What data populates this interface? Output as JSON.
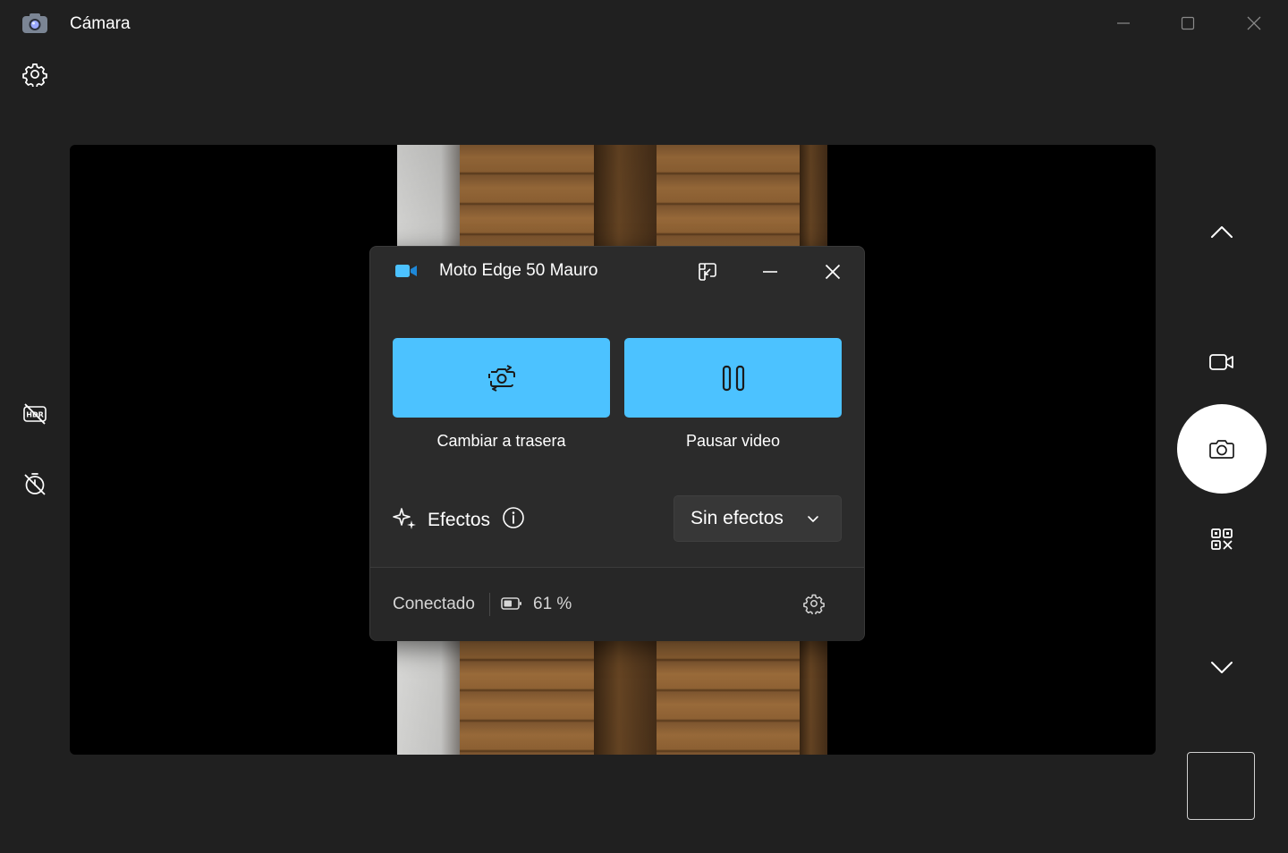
{
  "window": {
    "title": "Cámara"
  },
  "toolbar": {
    "settings_icon": "gear-icon"
  },
  "left_controls": [
    {
      "name": "hdr-off-icon"
    },
    {
      "name": "timer-off-icon"
    }
  ],
  "right_controls": {
    "up": "chevron-up-icon",
    "video_mode": "video-camera-icon",
    "shutter": "camera-icon",
    "qr_mode": "qr-code-icon",
    "down": "chevron-down-icon"
  },
  "phone_dialog": {
    "title": "Moto Edge 50 Mauro",
    "switch_label": "Cambiar a trasera",
    "pause_label": "Pausar video",
    "effects_label": "Efectos",
    "effects_value": "Sin efectos",
    "status": "Conectado",
    "battery": "61 %",
    "battery_level_percent": 61,
    "accent_color": "#4cc2ff"
  }
}
